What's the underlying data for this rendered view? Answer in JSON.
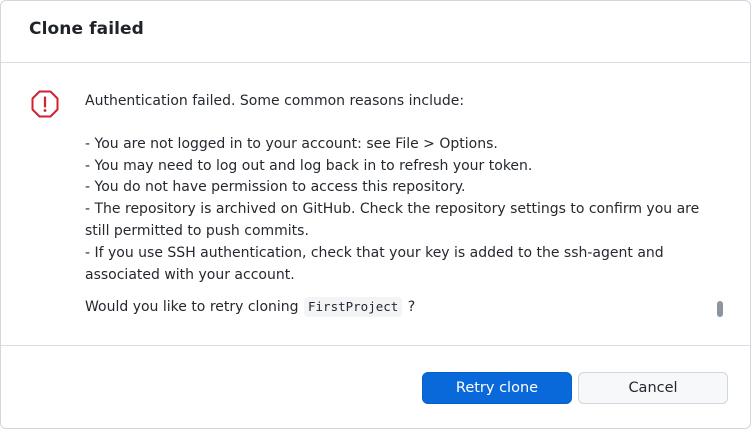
{
  "dialog": {
    "title": "Clone failed"
  },
  "message": {
    "intro": "Authentication failed. Some common reasons include:",
    "reasons": [
      "- You are not logged in to your account: see File > Options.",
      "- You may need to log out and log back in to refresh your token.",
      "- You do not have permission to access this repository.",
      "- The repository is archived on GitHub. Check the repository settings to confirm you are still permitted to push commits.",
      "- If you use SSH authentication, check that your key is added to the ssh-agent and associated with your account."
    ],
    "question_before": "Would you like to retry cloning",
    "repo_name": "FirstProject",
    "question_after": "?"
  },
  "icons": {
    "alert": "octagon-alert-icon"
  },
  "colors": {
    "primary": "#0969da",
    "alert": "#cf222e"
  },
  "buttons": {
    "retry_label": "Retry clone",
    "cancel_label": "Cancel"
  }
}
